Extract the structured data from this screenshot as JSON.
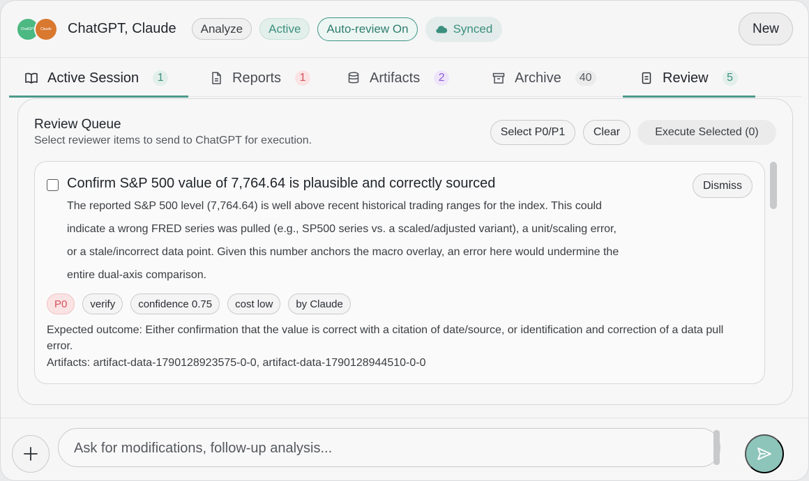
{
  "header": {
    "avatars": [
      {
        "name": "chatgpt-avatar",
        "label": "ChatGPT",
        "color": "#4cb882"
      },
      {
        "name": "claude-avatar",
        "label": "Claude",
        "color": "#d9782f"
      }
    ],
    "title": "ChatGPT, Claude",
    "pills": {
      "analyze": "Analyze",
      "active": "Active",
      "auto_review": "Auto-review On",
      "synced": "Synced"
    },
    "new_label": "New"
  },
  "tabs": [
    {
      "label": "Active Session",
      "count": "1",
      "icon": "book-icon"
    },
    {
      "label": "Reports",
      "count": "1",
      "icon": "document-icon"
    },
    {
      "label": "Artifacts",
      "count": "2",
      "icon": "database-icon"
    },
    {
      "label": "Archive",
      "count": "40",
      "icon": "archive-icon"
    },
    {
      "label": "Review",
      "count": "5",
      "icon": "review-icon"
    }
  ],
  "selected_tabs": [
    "Active Session",
    "Review"
  ],
  "review": {
    "title": "Review Queue",
    "subtitle": "Select reviewer items to send to ChatGPT for execution.",
    "select_label": "Select P0/P1",
    "clear_label": "Clear",
    "execute_label": "Execute Selected (0)",
    "item": {
      "title": "Confirm S&P 500 value of 7,764.64 is plausible and correctly sourced",
      "dismiss_label": "Dismiss",
      "description_lines": [
        "The reported S&P 500 level (7,764.64) is well above recent historical trading ranges for the index. This could",
        "indicate a wrong FRED series was pulled (e.g., SP500 series vs. a scaled/adjusted variant), a unit/scaling error,",
        "or a stale/incorrect data point. Given this number anchors the macro overlay, an error here would undermine the",
        "entire dual-axis comparison."
      ],
      "tags": {
        "priority": "P0",
        "kind": "verify",
        "confidence": "confidence 0.75",
        "cost": "cost low",
        "author": "by Claude"
      },
      "outcome": "Expected outcome: Either confirmation that the value is correct with a citation of date/source, or identification and correction of a data pull error.",
      "artifacts": "Artifacts: artifact-data-1790128923575-0-0, artifact-data-1790128944510-0-0"
    }
  },
  "composer": {
    "placeholder": "Ask for modifications, follow-up analysis..."
  },
  "colors": {
    "accent": "#4c9a8b",
    "send_button": "#8ec5bb",
    "priority_red": "#d2525c"
  }
}
